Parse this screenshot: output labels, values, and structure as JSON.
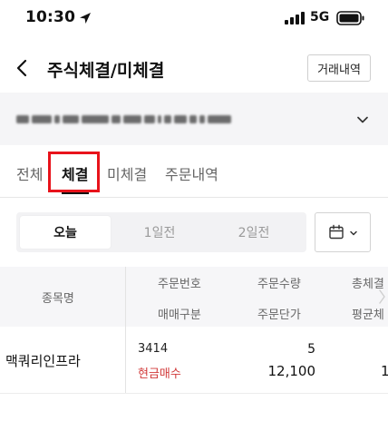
{
  "status_bar": {
    "time": "10:30",
    "network": "5G"
  },
  "header": {
    "title": "주식체결/미체결",
    "history_button": "거래내역"
  },
  "tabs": [
    {
      "label": "전체",
      "active": false
    },
    {
      "label": "체결",
      "active": true
    },
    {
      "label": "미체결",
      "active": false
    },
    {
      "label": "주문내역",
      "active": false
    }
  ],
  "day_filter": {
    "options": [
      {
        "label": "오늘",
        "active": true
      },
      {
        "label": "1일전",
        "active": false
      },
      {
        "label": "2일전",
        "active": false
      }
    ]
  },
  "table": {
    "headers": {
      "stock_name": "종목명",
      "order_no": "주문번호",
      "trade_type": "매매구분",
      "order_qty": "주문수량",
      "order_price": "주문단가",
      "filled_total": "총체결",
      "avg_price": "평균체"
    },
    "rows": [
      {
        "stock_name": "맥쿼리인프라",
        "order_no": "3414",
        "trade_type": "현금매수",
        "order_qty": "5",
        "order_price": "12,100",
        "filled_partial": "1"
      }
    ]
  },
  "colors": {
    "highlight": "#e8131b",
    "buy": "#d13a3a"
  }
}
